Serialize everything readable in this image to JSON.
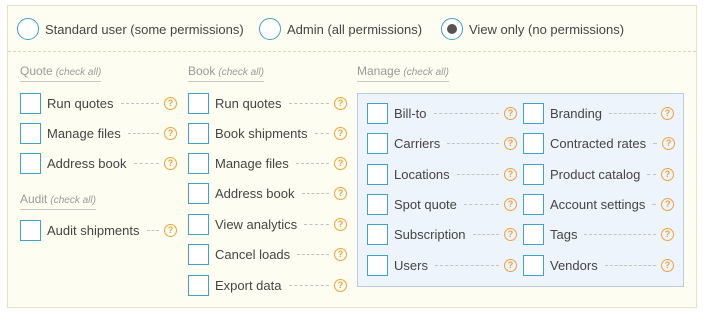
{
  "roles": [
    {
      "label": "Standard user (some permissions)",
      "selected": false
    },
    {
      "label": "Admin (all permissions)",
      "selected": false
    },
    {
      "label": "View only (no permissions)",
      "selected": true
    }
  ],
  "check_all_label": "(check all)",
  "help_glyph": "?",
  "colors": {
    "accent": "#3fa3c4",
    "help": "#f0a23b",
    "panel_bg": "#fefdf1",
    "manage_bg": "#edf4fb"
  },
  "sections": {
    "quote": {
      "title": "Quote",
      "items": [
        "Run quotes",
        "Manage files",
        "Address book"
      ]
    },
    "audit": {
      "title": "Audit",
      "items": [
        "Audit shipments"
      ]
    },
    "book": {
      "title": "Book",
      "items": [
        "Run quotes",
        "Book shipments",
        "Manage files",
        "Address book",
        "View analytics",
        "Cancel loads",
        "Export data"
      ]
    },
    "manage": {
      "title": "Manage",
      "left_items": [
        "Bill-to",
        "Carriers",
        "Locations",
        "Spot quote",
        "Subscription",
        "Users"
      ],
      "right_items": [
        "Branding",
        "Contracted rates",
        "Product catalog",
        "Account settings",
        "Tags",
        "Vendors"
      ]
    }
  }
}
